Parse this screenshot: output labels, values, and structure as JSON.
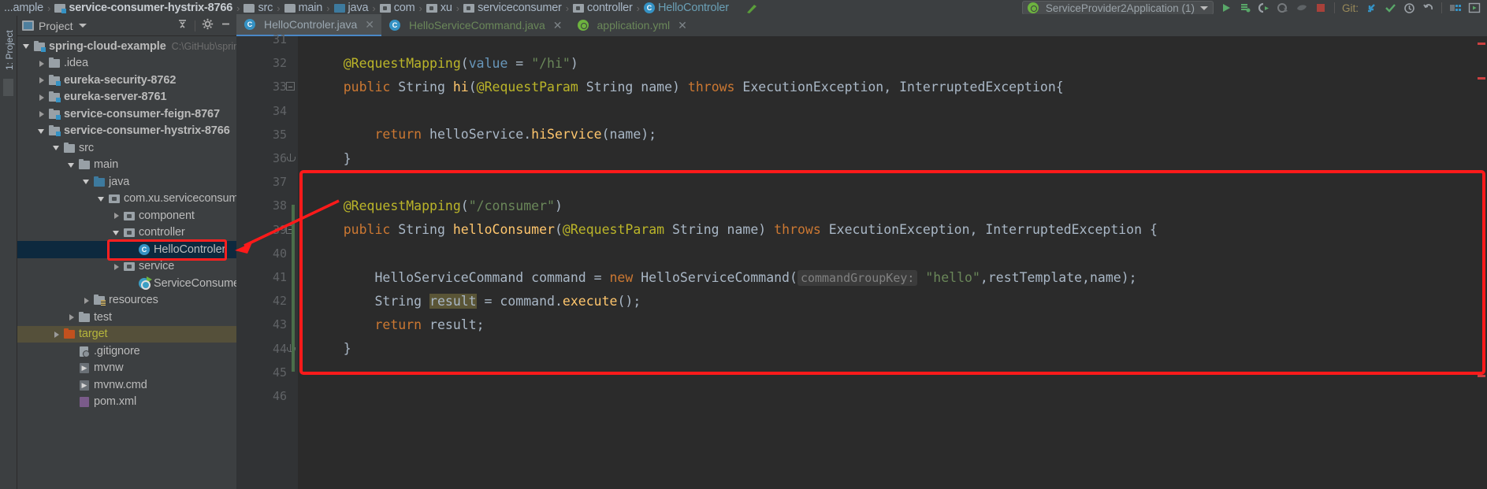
{
  "window": {
    "app": "IntelliJ IDEA",
    "theme_bg": "#3c3f41",
    "editor_bg": "#2b2b2b",
    "accent": "#3592c4",
    "annotation_color": "#ff1a1a"
  },
  "navbar": {
    "breadcrumbs": [
      {
        "label": "...ample",
        "icon": "none",
        "bold": false
      },
      {
        "label": "service-consumer-hystrix-8766",
        "icon": "module-icon",
        "bold": true
      },
      {
        "label": "src",
        "icon": "folder-icon",
        "bold": false
      },
      {
        "label": "main",
        "icon": "folder-icon",
        "bold": false
      },
      {
        "label": "java",
        "icon": "source-folder-icon",
        "bold": false
      },
      {
        "label": "com",
        "icon": "package-icon",
        "bold": false
      },
      {
        "label": "xu",
        "icon": "package-icon",
        "bold": false
      },
      {
        "label": "serviceconsumer",
        "icon": "package-icon",
        "bold": false
      },
      {
        "label": "controller",
        "icon": "package-icon",
        "bold": false
      },
      {
        "label": "HelloControler",
        "icon": "class-icon",
        "bold": false
      }
    ],
    "run_config": "ServiceProvider2Application (1)",
    "git_label": "Git:",
    "toolbar_icons": [
      "run-icon",
      "debug-icon",
      "run-with-coverage-icon",
      "profile-icon",
      "attach-debugger-icon",
      "stop-icon",
      "update-project-icon",
      "commit-icon",
      "history-icon",
      "rollback-icon",
      "layout-icon",
      "preview-icon"
    ]
  },
  "stripe": {
    "label": "1: Project"
  },
  "project_panel": {
    "title": "Project",
    "collapse_all_icon": "collapse-all-icon",
    "settings_icon": "gear-icon",
    "hide_icon": "minimize-icon"
  },
  "tree": {
    "items": [
      {
        "label": "spring-cloud-example",
        "path": "C:\\GitHub\\spring",
        "indent": 0,
        "state": "expanded",
        "icon": "module-icon",
        "bold": true,
        "selected": false
      },
      {
        "label": ".idea",
        "path": "",
        "indent": 1,
        "state": "collapsed",
        "icon": "folder-icon",
        "bold": false,
        "selected": false
      },
      {
        "label": "eureka-security-8762",
        "path": "",
        "indent": 1,
        "state": "collapsed",
        "icon": "module-icon",
        "bold": true,
        "selected": false
      },
      {
        "label": "eureka-server-8761",
        "path": "",
        "indent": 1,
        "state": "collapsed",
        "icon": "module-icon",
        "bold": true,
        "selected": false
      },
      {
        "label": "service-consumer-feign-8767",
        "path": "",
        "indent": 1,
        "state": "collapsed",
        "icon": "module-icon",
        "bold": true,
        "selected": false
      },
      {
        "label": "service-consumer-hystrix-8766",
        "path": "",
        "indent": 1,
        "state": "expanded",
        "icon": "module-icon",
        "bold": true,
        "selected": false
      },
      {
        "label": "src",
        "path": "",
        "indent": 2,
        "state": "expanded",
        "icon": "folder-icon",
        "bold": false,
        "selected": false
      },
      {
        "label": "main",
        "path": "",
        "indent": 3,
        "state": "expanded",
        "icon": "folder-icon",
        "bold": false,
        "selected": false
      },
      {
        "label": "java",
        "path": "",
        "indent": 4,
        "state": "expanded",
        "icon": "source-folder-icon",
        "bold": false,
        "selected": false
      },
      {
        "label": "com.xu.serviceconsumer",
        "path": "",
        "indent": 5,
        "state": "expanded",
        "icon": "package-icon",
        "bold": false,
        "selected": false
      },
      {
        "label": "component",
        "path": "",
        "indent": 6,
        "state": "collapsed",
        "icon": "package-icon",
        "bold": false,
        "selected": false
      },
      {
        "label": "controller",
        "path": "",
        "indent": 6,
        "state": "expanded",
        "icon": "package-icon",
        "bold": false,
        "selected": false
      },
      {
        "label": "HelloControler",
        "path": "",
        "indent": 7,
        "state": "leaf",
        "icon": "class-icon",
        "bold": false,
        "selected": true
      },
      {
        "label": "service",
        "path": "",
        "indent": 6,
        "state": "collapsed",
        "icon": "package-icon",
        "bold": false,
        "selected": false
      },
      {
        "label": "ServiceConsumerAppli",
        "path": "",
        "indent": 7,
        "state": "leaf",
        "icon": "spring-class-icon",
        "bold": false,
        "selected": false
      },
      {
        "label": "resources",
        "path": "",
        "indent": 4,
        "state": "collapsed",
        "icon": "resources-folder-icon",
        "bold": false,
        "selected": false
      },
      {
        "label": "test",
        "path": "",
        "indent": 3,
        "state": "collapsed",
        "icon": "folder-icon",
        "bold": false,
        "selected": false
      },
      {
        "label": "target",
        "path": "",
        "indent": 2,
        "state": "collapsed",
        "icon": "target-folder-icon",
        "bold": false,
        "selected": false,
        "highlight": true
      },
      {
        "label": ".gitignore",
        "path": "",
        "indent": 3,
        "state": "leaf",
        "icon": "gitignore-file-icon",
        "bold": false,
        "selected": false
      },
      {
        "label": "mvnw",
        "path": "",
        "indent": 3,
        "state": "leaf",
        "icon": "script-file-icon",
        "bold": false,
        "selected": false
      },
      {
        "label": "mvnw.cmd",
        "path": "",
        "indent": 3,
        "state": "leaf",
        "icon": "script-file-icon",
        "bold": false,
        "selected": false
      },
      {
        "label": "pom.xml",
        "path": "",
        "indent": 3,
        "state": "leaf",
        "icon": "maven-file-icon",
        "bold": false,
        "selected": false
      }
    ]
  },
  "editor": {
    "tabs": [
      {
        "label": "HelloControler.java",
        "icon": "class-icon",
        "active": true,
        "color": "#9aa7b0"
      },
      {
        "label": "HelloServiceCommand.java",
        "icon": "class-icon",
        "active": false,
        "color": "#6a8759"
      },
      {
        "label": "application.yml",
        "icon": "spring-file-icon",
        "active": false,
        "color": "#6a8759"
      }
    ],
    "first_line": 31,
    "lines": [
      {
        "n": 31,
        "tokens": []
      },
      {
        "n": 32,
        "tokens": [
          {
            "t": "    ",
            "c": "plain"
          },
          {
            "t": "@RequestMapping",
            "c": "ann"
          },
          {
            "t": "(",
            "c": "plain"
          },
          {
            "t": "value",
            "c": "num"
          },
          {
            "t": " = ",
            "c": "plain"
          },
          {
            "t": "\"/hi\"",
            "c": "str"
          },
          {
            "t": ")",
            "c": "plain"
          }
        ]
      },
      {
        "n": 33,
        "fold": "start",
        "tokens": [
          {
            "t": "    ",
            "c": "plain"
          },
          {
            "t": "public",
            "c": "kw"
          },
          {
            "t": " ",
            "c": "plain"
          },
          {
            "t": "String",
            "c": "type"
          },
          {
            "t": " ",
            "c": "plain"
          },
          {
            "t": "hi",
            "c": "fn"
          },
          {
            "t": "(",
            "c": "plain"
          },
          {
            "t": "@RequestParam",
            "c": "ann"
          },
          {
            "t": " ",
            "c": "plain"
          },
          {
            "t": "String",
            "c": "type"
          },
          {
            "t": " name) ",
            "c": "plain"
          },
          {
            "t": "throws",
            "c": "kw"
          },
          {
            "t": " ExecutionException, InterruptedException{",
            "c": "plain"
          }
        ]
      },
      {
        "n": 34,
        "tokens": []
      },
      {
        "n": 35,
        "tokens": [
          {
            "t": "        ",
            "c": "plain"
          },
          {
            "t": "return",
            "c": "kw"
          },
          {
            "t": " helloService.",
            "c": "plain"
          },
          {
            "t": "hiService",
            "c": "fn"
          },
          {
            "t": "(name);",
            "c": "plain"
          }
        ]
      },
      {
        "n": 36,
        "fold": "end",
        "tokens": [
          {
            "t": "    }",
            "c": "plain"
          }
        ]
      },
      {
        "n": 37,
        "tokens": []
      },
      {
        "n": 38,
        "tokens": [
          {
            "t": "    ",
            "c": "plain"
          },
          {
            "t": "@RequestMapping",
            "c": "ann"
          },
          {
            "t": "(",
            "c": "plain"
          },
          {
            "t": "\"/consumer\"",
            "c": "str"
          },
          {
            "t": ")",
            "c": "plain"
          }
        ]
      },
      {
        "n": 39,
        "fold": "start",
        "tokens": [
          {
            "t": "    ",
            "c": "plain"
          },
          {
            "t": "public",
            "c": "kw"
          },
          {
            "t": " ",
            "c": "plain"
          },
          {
            "t": "String",
            "c": "type"
          },
          {
            "t": " ",
            "c": "plain"
          },
          {
            "t": "helloConsumer",
            "c": "fn"
          },
          {
            "t": "(",
            "c": "plain"
          },
          {
            "t": "@RequestParam",
            "c": "ann"
          },
          {
            "t": " ",
            "c": "plain"
          },
          {
            "t": "String",
            "c": "type"
          },
          {
            "t": " name) ",
            "c": "plain"
          },
          {
            "t": "throws",
            "c": "kw"
          },
          {
            "t": " ExecutionException, InterruptedException {",
            "c": "plain"
          }
        ]
      },
      {
        "n": 40,
        "tokens": []
      },
      {
        "n": 41,
        "tokens": [
          {
            "t": "        HelloServiceCommand command = ",
            "c": "plain"
          },
          {
            "t": "new",
            "c": "kw"
          },
          {
            "t": " HelloServiceCommand(",
            "c": "plain"
          },
          {
            "t": "commandGroupKey:",
            "c": "hint"
          },
          {
            "t": " ",
            "c": "plain"
          },
          {
            "t": "\"hello\"",
            "c": "str"
          },
          {
            "t": ",restTemplate,name);",
            "c": "plain"
          }
        ]
      },
      {
        "n": 42,
        "tokens": [
          {
            "t": "        String ",
            "c": "plain"
          },
          {
            "t": "result",
            "c": "hl-ident"
          },
          {
            "t": " = command.",
            "c": "plain"
          },
          {
            "t": "execute",
            "c": "fn"
          },
          {
            "t": "();",
            "c": "plain"
          }
        ]
      },
      {
        "n": 43,
        "tokens": [
          {
            "t": "        ",
            "c": "plain"
          },
          {
            "t": "return",
            "c": "kw"
          },
          {
            "t": " result;",
            "c": "plain"
          }
        ]
      },
      {
        "n": 44,
        "fold": "end",
        "tokens": [
          {
            "t": "    }",
            "c": "plain"
          }
        ]
      },
      {
        "n": 45,
        "tokens": []
      },
      {
        "n": 46,
        "tokens": []
      }
    ]
  },
  "annotations": {
    "tree_box": "red-rectangle-around-HelloControler",
    "code_box": "red-rectangle-around-helloConsumer-method",
    "arrow": "red-arrow-from-tree-to-code"
  }
}
